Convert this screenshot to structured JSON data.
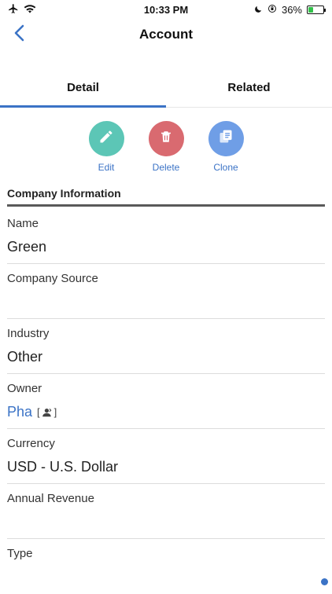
{
  "status_bar": {
    "time": "10:33 PM",
    "battery_percent": "36%",
    "battery_level": 0.36,
    "icons": [
      "airplane-icon",
      "wifi-icon",
      "moon-icon",
      "orientation-lock-icon",
      "battery-icon"
    ]
  },
  "nav": {
    "title": "Account",
    "back_icon": "chevron-left-icon"
  },
  "tabs": [
    {
      "label": "Detail",
      "active": true
    },
    {
      "label": "Related",
      "active": false
    }
  ],
  "actions": [
    {
      "label": "Edit",
      "icon": "pencil-icon",
      "color": "#5cc6b6"
    },
    {
      "label": "Delete",
      "icon": "trash-icon",
      "color": "#d96a70"
    },
    {
      "label": "Clone",
      "icon": "clone-icon",
      "color": "#6f9ee6"
    }
  ],
  "section": {
    "title": "Company Information"
  },
  "fields": [
    {
      "label": "Name",
      "value": "Green"
    },
    {
      "label": "Company Source",
      "value": ""
    },
    {
      "label": "Industry",
      "value": "Other"
    },
    {
      "label": "Owner",
      "value": "Pha",
      "link": true
    },
    {
      "label": "Currency",
      "value": "USD - U.S. Dollar"
    },
    {
      "label": "Annual Revenue",
      "value": ""
    },
    {
      "label": "Type",
      "value": ""
    }
  ],
  "colors": {
    "accent": "#3b73c6",
    "battery_green": "#32c24a",
    "divider": "#dcdcdc",
    "section_rule": "#5a5a5a"
  }
}
